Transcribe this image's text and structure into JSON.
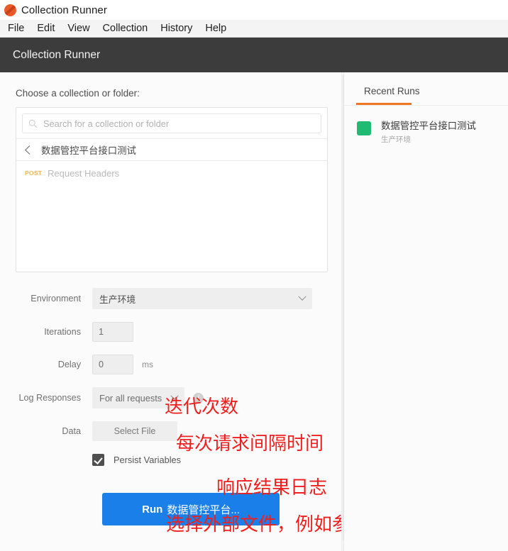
{
  "window": {
    "title": "Collection Runner",
    "logo_icon": "postman-logo-icon"
  },
  "menubar": {
    "items": [
      {
        "label": "File"
      },
      {
        "label": "Edit"
      },
      {
        "label": "View"
      },
      {
        "label": "Collection"
      },
      {
        "label": "History"
      },
      {
        "label": "Help"
      }
    ]
  },
  "header": {
    "title": "Collection Runner",
    "background": "#3c3c3c"
  },
  "left": {
    "choose_label": "Choose a collection or folder:",
    "search": {
      "placeholder": "Search for a collection or folder",
      "value": "",
      "icon": "search-icon"
    },
    "breadcrumb": {
      "back_icon": "chevron-left-icon",
      "name": "数据管控平台接口测试"
    },
    "requests": [
      {
        "method": "POST",
        "name": "Request Headers"
      }
    ],
    "form": {
      "environment": {
        "label": "Environment",
        "value": "生产环境",
        "chevron": "chevron-down-icon"
      },
      "iterations": {
        "label": "Iterations",
        "value": "1"
      },
      "delay": {
        "label": "Delay",
        "value": "0",
        "unit": "ms"
      },
      "log_responses": {
        "label": "Log Responses",
        "value": "For all requests",
        "chevron": "chevron-down-icon",
        "info_icon": "info-icon"
      },
      "data": {
        "label": "Data",
        "button_label": "Select File"
      },
      "persist_variables": {
        "label": "Persist Variables",
        "checked": true
      }
    },
    "run_button": {
      "prefix": "Run",
      "target": "数据管控平台..."
    }
  },
  "annotations": {
    "color": "#f01f1f",
    "items": [
      {
        "text": "迭代次数"
      },
      {
        "text": "每次请求间隔时间"
      },
      {
        "text": "响应结果日志"
      },
      {
        "text": "选择外部文件，例如参数化文件"
      }
    ]
  },
  "right": {
    "tab_label": "Recent Runs",
    "accent_color": "#ef7721",
    "runs": [
      {
        "name": "数据管控平台接口测试",
        "environment": "生产环境",
        "status_color": "#21ba72"
      }
    ]
  }
}
